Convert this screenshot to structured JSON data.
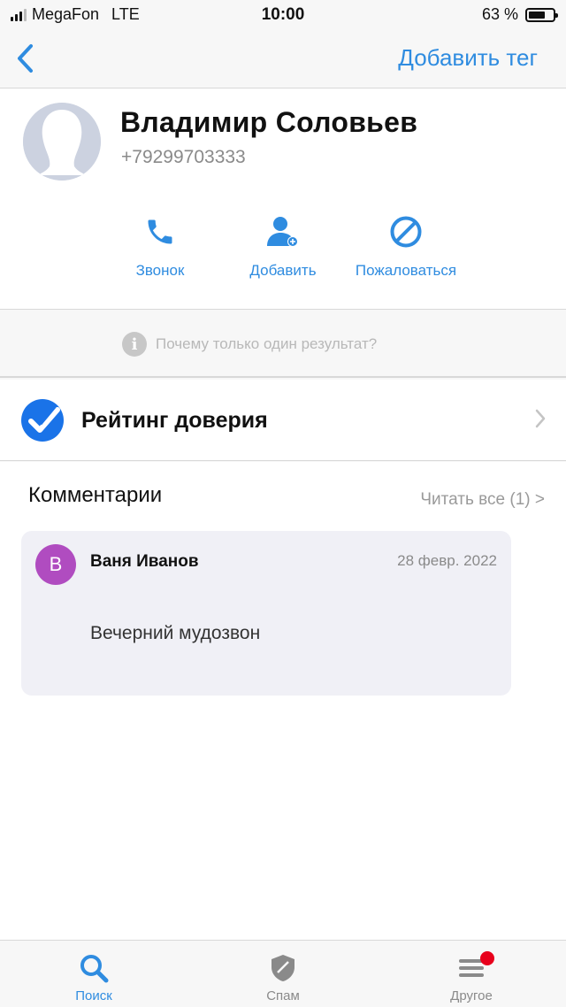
{
  "status_bar": {
    "carrier": "MegaFon",
    "network": "LTE",
    "time": "10:00",
    "battery": "63 %"
  },
  "nav": {
    "back_icon": "chevron-left-icon",
    "add_tag_label": "Добавить тег"
  },
  "contact": {
    "name": "Владимир Соловьев",
    "phone": "+79299703333"
  },
  "actions": [
    {
      "label": "Звонок",
      "icon": "phone-icon"
    },
    {
      "label": "Добавить",
      "icon": "add-contact-icon"
    },
    {
      "label": "Пожаловаться",
      "icon": "block-icon"
    }
  ],
  "why_text": "Почему только один результат?",
  "rating": {
    "label": "Рейтинг доверия"
  },
  "comments": {
    "title": "Комментарии",
    "read_all": "Читать все (1) >",
    "items": [
      {
        "initial": "В",
        "author": "Ваня Иванов",
        "date": "28 февр. 2022",
        "text": "Вечерний мудозвон"
      }
    ]
  },
  "tabs": [
    {
      "label": "Поиск",
      "icon": "search-icon",
      "active": true
    },
    {
      "label": "Спам",
      "icon": "shield-icon",
      "active": false
    },
    {
      "label": "Другое",
      "icon": "menu-icon",
      "active": false,
      "badge": true
    }
  ],
  "colors": {
    "accent": "#2f8ce0",
    "badge": "#e8001c",
    "comment_avatar": "#b04cc0"
  }
}
